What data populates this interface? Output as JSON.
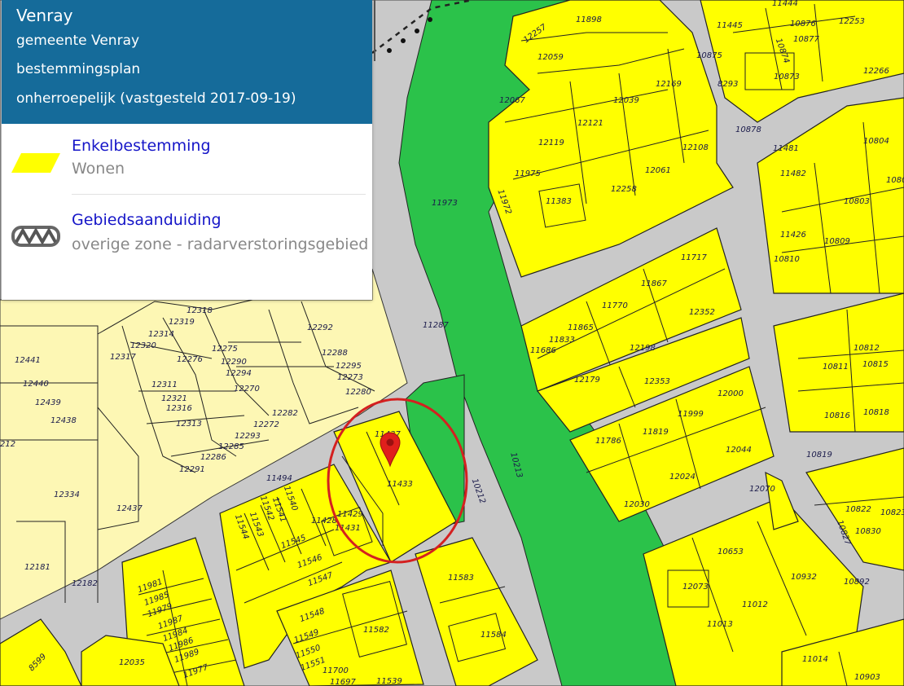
{
  "panel": {
    "place": "Venray",
    "municipality": "gemeente Venray",
    "plan_type": "bestemmingsplan",
    "status": "onherroepelijk (vastgesteld 2017-09-19)"
  },
  "legend": [
    {
      "category": "Enkelbestemming",
      "value": "Wonen",
      "symbol": "yellow-parallelogram-icon",
      "color": "#ffff00"
    },
    {
      "category": "Gebiedsaanduiding",
      "value": "overige zone - radarverstoringsgebied",
      "symbol": "hatched-zone-icon",
      "color": "#777777"
    }
  ],
  "colors": {
    "wonen": "#ffff00",
    "green": "#2bc24a",
    "light_zone": "#fdf7b4",
    "road": "#c9c9c9",
    "header": "#156b9a",
    "marker": "#e0201c",
    "circle": "#d42020"
  },
  "marker": {
    "parcel": "11433"
  },
  "parcels": {
    "p12257": "12257",
    "p11898": "11898",
    "p11444": "11444",
    "p11445": "11445",
    "p10876": "10876",
    "p12253": "12253",
    "p10874": "10874",
    "p10877": "10877",
    "p12059": "12059",
    "p10875": "10875",
    "p12266": "12266",
    "p8293": "8293",
    "p10873": "10873",
    "p12169": "12169",
    "p12067": "12067",
    "p12039": "12039",
    "p12121": "12121",
    "p10878": "10878",
    "p12119": "12119",
    "p12108": "12108",
    "p10804": "10804",
    "p11481": "11481",
    "p11482": "11482",
    "p11975": "11975",
    "p12061": "12061",
    "p10805": "1080",
    "p11973": "11973",
    "p11972": "11972",
    "p11383": "11383",
    "p12258": "12258",
    "p10803": "10803",
    "p11426": "11426",
    "p10809": "10809",
    "p10810": "10810",
    "p11717": "11717",
    "p11867": "11867",
    "p11770": "11770",
    "p12352": "12352",
    "p12318": "12318",
    "p12319": "12319",
    "p12314": "12314",
    "p12292": "12292",
    "p12320": "12320",
    "p12317": "12317",
    "p12276": "12276",
    "p12275": "12275",
    "p12290": "12290",
    "p12288": "12288",
    "p12294": "12294",
    "p12295": "12295",
    "p12273": "12273",
    "p12441": "12441",
    "p12440": "12440",
    "p12311": "12311",
    "p12270": "12270",
    "p12280": "12280",
    "p12439": "12439",
    "p12321": "12321",
    "p12316": "12316",
    "p12438": "12438",
    "p12313": "12313",
    "p12282": "12282",
    "p12272": "12272",
    "p12293": "12293",
    "p212": "212",
    "p12285": "12285",
    "p12286": "12286",
    "p12291": "12291",
    "p11287": "11287",
    "p11865": "11865",
    "p11833": "11833",
    "p11686": "11686",
    "p12198": "12198",
    "p10812": "10812",
    "p10815": "10815",
    "p12179": "12179",
    "p12353": "12353",
    "p10811": "10811",
    "p12000": "12000",
    "p11999": "11999",
    "p10816": "10816",
    "p10818": "10818",
    "p11437": "11437",
    "p11819": "11819",
    "p11786": "11786",
    "p12044": "12044",
    "p10213": "10213",
    "p10819": "10819",
    "p11494": "11494",
    "p11433": "11433",
    "p10212": "10212",
    "p12024": "12024",
    "p12334": "12334",
    "p11540": "11540",
    "p11542": "11542",
    "p11541": "11541",
    "p12437": "12437",
    "p11429": "11429",
    "p11428": "11428",
    "p12070": "12070",
    "p12030": "12030",
    "p10822": "10822",
    "p10823": "10823",
    "p11544": "11544",
    "p11543": "11543",
    "p11431": "11431",
    "p11545": "11545",
    "p10827": "10827",
    "p10830": "10830",
    "p12181": "12181",
    "p11546": "11546",
    "p10653": "10653",
    "p11583": "11583",
    "p11547": "11547",
    "p12182": "12182",
    "p11981": "11981",
    "p10932": "10932",
    "p10892": "10892",
    "p12073": "12073",
    "p11985": "11985",
    "p11979": "11979",
    "p11987": "11987",
    "p11012": "11012",
    "p11548": "11548",
    "p11582": "11582",
    "p11984": "11984",
    "p11013": "11013",
    "p11584": "11584",
    "p11986": "11986",
    "p11549": "11549",
    "p8599": "8599",
    "p11550": "11550",
    "p11989": "11989",
    "p12035": "12035",
    "p11551": "11551",
    "p11977": "11977",
    "p11014": "11014",
    "p11700": "11700",
    "p10903": "10903",
    "p11697": "11697",
    "p11539": "11539"
  }
}
